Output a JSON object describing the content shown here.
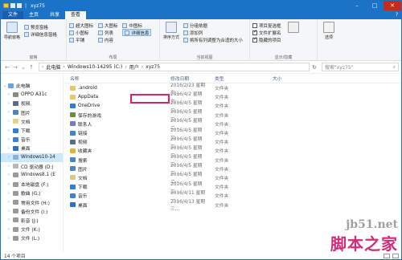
{
  "window": {
    "title": "xyz75",
    "sep": "|",
    "controls": [
      "–",
      "□",
      "✕"
    ]
  },
  "tabs": [
    {
      "label": "文件",
      "kind": "file"
    },
    {
      "label": "主页",
      "kind": "normal"
    },
    {
      "label": "共享",
      "kind": "normal"
    },
    {
      "label": "查看",
      "kind": "active"
    }
  ],
  "help_icon": "?",
  "ribbon": {
    "pane": {
      "label": "窗格",
      "nav_pane": "导航窗格",
      "preview": "预览窗格",
      "details": "详细信息窗格"
    },
    "layout": {
      "label": "布局",
      "items": [
        "超大图标",
        "大图标",
        "中图标",
        "小图标",
        "列表",
        "详细信息",
        "平铺",
        "内容"
      ]
    },
    "current_view": {
      "label": "当前视图",
      "sort": "排序方式",
      "group": "分组依据",
      "add_col": "添加列",
      "fit_cols": "将所有列调整为合适的大小"
    },
    "show_hide": {
      "label": "显示/隐藏",
      "item_check": "项目复选框",
      "ext": "文件扩展名",
      "hidden": "隐藏的项目",
      "hide_selected": "隐藏所选项目"
    },
    "options": "选项"
  },
  "address": {
    "crumbs": [
      "此电脑",
      "Windows10-14295 (C:)",
      "用户",
      "xyz75"
    ],
    "search_placeholder": "搜索\"xyz75\""
  },
  "sidebar": [
    {
      "label": "此电脑",
      "color": "#6aa4dc",
      "level": 0,
      "expanded": true
    },
    {
      "label": "OPPO A31c",
      "color": "#8a8a8a",
      "level": 1
    },
    {
      "label": "视频",
      "color": "#5a6e8c",
      "level": 1
    },
    {
      "label": "图片",
      "color": "#4b86c2",
      "level": 1
    },
    {
      "label": "文档",
      "color": "#e6d38a",
      "level": 1
    },
    {
      "label": "下载",
      "color": "#2f7fd1",
      "level": 1
    },
    {
      "label": "音乐",
      "color": "#3a86d6",
      "level": 1
    },
    {
      "label": "桌面",
      "color": "#2b73c2",
      "level": 1
    },
    {
      "label": "Windows10-14",
      "color": "#8ab0d4",
      "level": 1,
      "selected": true
    },
    {
      "label": "CD 驱动器 (D:)",
      "color": "#b8b8b8",
      "level": 1
    },
    {
      "label": "Windows8.1 (E",
      "color": "#9a9a9a",
      "level": 1
    },
    {
      "label": "本地磁盘 (F:)",
      "color": "#9a9a9a",
      "level": 1
    },
    {
      "label": "歌曲 (G:)",
      "color": "#9a9a9a",
      "level": 1
    },
    {
      "label": "常用文件 (H:)",
      "color": "#9a9a9a",
      "level": 1
    },
    {
      "label": "备份文件 (I:)",
      "color": "#9a9a9a",
      "level": 1
    },
    {
      "label": "影音 (J:)",
      "color": "#9a9a9a",
      "level": 1
    },
    {
      "label": "文件 (K:)",
      "color": "#9a9a9a",
      "level": 1
    },
    {
      "label": "文件 (L:)",
      "color": "#9a9a9a",
      "level": 1
    }
  ],
  "columns": {
    "name": "名称",
    "date": "修改日期",
    "type": "类型",
    "size": "大小"
  },
  "files": [
    {
      "name": ".android",
      "date": "2016/2/23 星期六...",
      "type": "文件夹",
      "color": "#e8c766"
    },
    {
      "name": "AppData",
      "date": "2016/4/2 星期六...",
      "type": "文件夹",
      "color": "#e8c766"
    },
    {
      "name": "OneDrive",
      "date": "2016/4/5 星期二...",
      "type": "文件夹",
      "color": "#2f7fd1"
    },
    {
      "name": "保存的游戏",
      "date": "2016/4/5 星期二...",
      "type": "文件夹",
      "color": "#6b8f3d"
    },
    {
      "name": "联系人",
      "date": "2016/4/5 星期二...",
      "type": "文件夹",
      "color": "#7b7bc4"
    },
    {
      "name": "链接",
      "date": "2016/4/5 星期二...",
      "type": "文件夹",
      "color": "#3a86d6"
    },
    {
      "name": "视频",
      "date": "2016/4/5 星期二...",
      "type": "文件夹",
      "color": "#5a6e8c"
    },
    {
      "name": "收藏夹",
      "date": "2016/4/5 星期二...",
      "type": "文件夹",
      "color": "#e0b43a"
    },
    {
      "name": "搜索",
      "date": "2016/4/5 星期二...",
      "type": "文件夹",
      "color": "#4b86c2"
    },
    {
      "name": "图片",
      "date": "2016/4/5 星期二...",
      "type": "文件夹",
      "color": "#4b86c2"
    },
    {
      "name": "文档",
      "date": "2016/4/5 星期二...",
      "type": "文件夹",
      "color": "#d9c68a"
    },
    {
      "name": "下载",
      "date": "2016/4/5 星期二...",
      "type": "文件夹",
      "color": "#2f7fd1"
    },
    {
      "name": "音乐",
      "date": "2016/4/11 星期一...",
      "type": "文件夹",
      "color": "#3a86d6"
    },
    {
      "name": "桌面",
      "date": "2016/4/13 星期三...",
      "type": "文件夹",
      "color": "#2b73c2"
    }
  ],
  "status": {
    "count": "14 个项目"
  },
  "watermark": {
    "site": "jb51.net",
    "logo": "脚本之家"
  },
  "accent": "#1a73c7",
  "highlight_color": "#d6265b"
}
